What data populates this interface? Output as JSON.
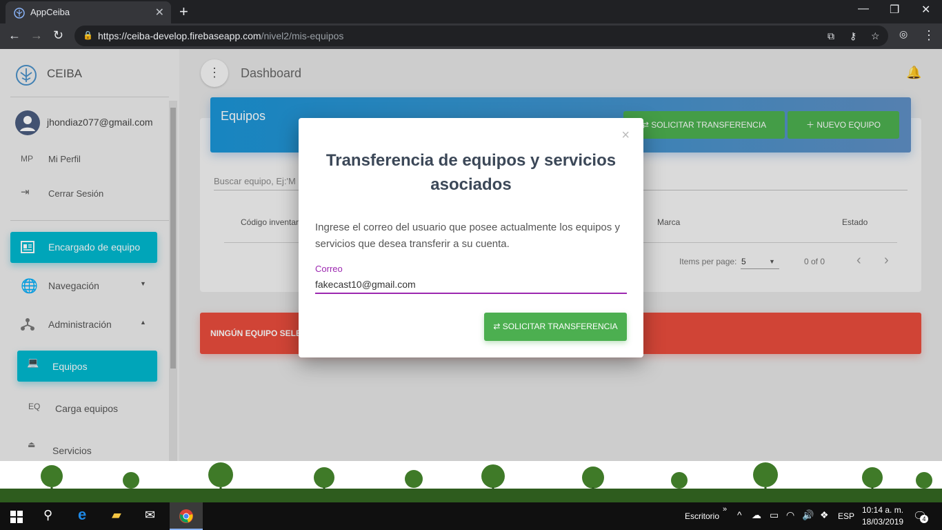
{
  "browser": {
    "tab_title": "AppCeiba",
    "url_host": "https://ceiba-develop.firebaseapp.com",
    "url_path": "/nivel2/mis-equipos"
  },
  "sidebar": {
    "logo": "CEIBA",
    "email": "jhondiaz077@gmail.com",
    "profile_abbr": "MP",
    "profile_label": "Mi Perfil",
    "logout_label": "Cerrar Sesión",
    "active_item": "Encargado de equipo",
    "nav_item": "Navegación",
    "admin_item": "Administración",
    "equipos_item": "Equipos",
    "carga_abbr": "EQ",
    "carga_item": "Carga equipos",
    "servicios_item": "Servicios"
  },
  "main": {
    "dashboard_title": "Dashboard",
    "card_title": "Equipos",
    "btn_transfer": "SOLICITAR TRANSFERENCIA",
    "btn_new": "NUEVO EQUIPO",
    "search_placeholder": "Buscar equipo, Ej:'M",
    "col_code": "Código inventar",
    "col_brand": "Marca",
    "col_state": "Estado",
    "items_per_page": "Items per page:",
    "page_size": "5",
    "page_range": "0 of 0",
    "alert_text": "NINGÚN EQUIPO SELEC"
  },
  "modal": {
    "close": "×",
    "title": "Transferencia de equipos y servicios asociados",
    "description": "Ingrese el correo del usuario que posee actualmente los equipos y servicios que desea transferir a su cuenta.",
    "field_label": "Correo",
    "field_value": "fakecast10@gmail.com",
    "submit": "SOLICITAR TRANSFERENCIA"
  },
  "taskbar": {
    "desktop": "Escritorio",
    "lang": "ESP",
    "time": "10:14 a. m.",
    "date": "18/03/2019",
    "notifications": "4"
  },
  "colors": {
    "accent_cyan": "#00b8cf",
    "green": "#4caf50",
    "red": "#e84c3d",
    "purple": "#9c27b0"
  }
}
